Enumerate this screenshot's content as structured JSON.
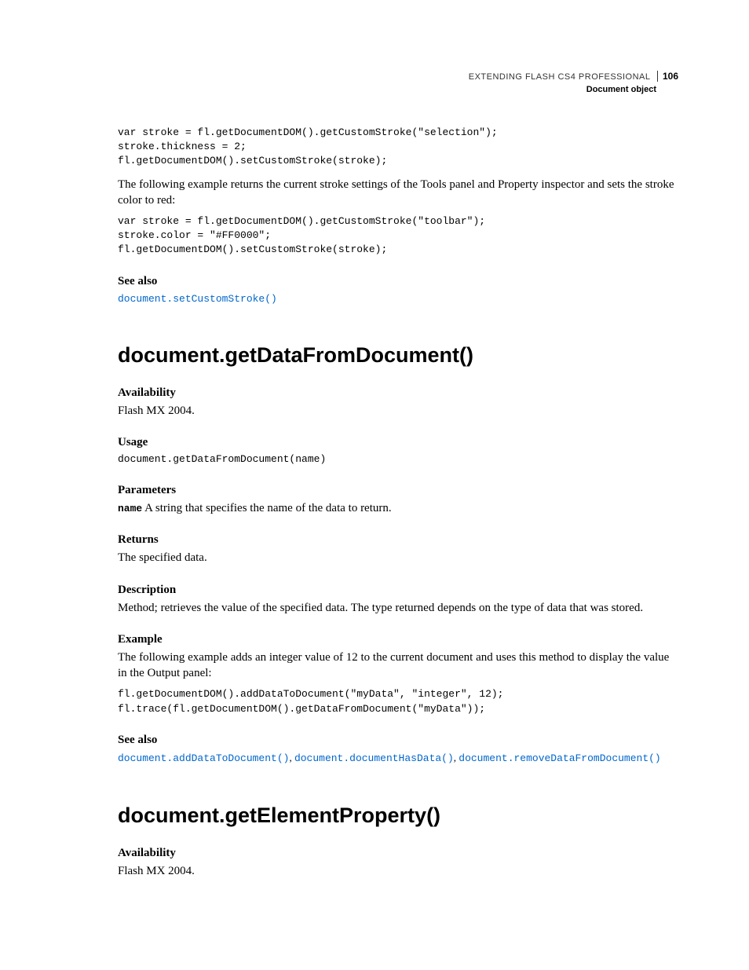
{
  "header": {
    "book_title": "EXTENDING FLASH CS4 PROFESSIONAL",
    "page_number": "106",
    "chapter": "Document object"
  },
  "block1": {
    "code": "var stroke = fl.getDocumentDOM().getCustomStroke(\"selection\");\nstroke.thickness = 2;\nfl.getDocumentDOM().setCustomStroke(stroke);",
    "para": "The following example returns the current stroke settings of the Tools panel and Property inspector and sets the stroke color to red:",
    "code2": "var stroke = fl.getDocumentDOM().getCustomStroke(\"toolbar\");\nstroke.color = \"#FF0000\";\nfl.getDocumentDOM().setCustomStroke(stroke);",
    "see_also_label": "See also",
    "see_also_link": "document.setCustomStroke()"
  },
  "method1": {
    "title": "document.getDataFromDocument()",
    "availability_label": "Availability",
    "availability_text": "Flash MX 2004.",
    "usage_label": "Usage",
    "usage_code": "document.getDataFromDocument(name)",
    "parameters_label": "Parameters",
    "param_name": "name",
    "param_desc": "  A string that specifies the name of the data to return.",
    "returns_label": "Returns",
    "returns_text": "The specified data.",
    "description_label": "Description",
    "description_text": "Method; retrieves the value of the specified data. The type returned depends on the type of data that was stored.",
    "example_label": "Example",
    "example_text": "The following example adds an integer value of 12 to the current document and uses this method to display the value in the Output panel:",
    "example_code": "fl.getDocumentDOM().addDataToDocument(\"myData\", \"integer\", 12);\nfl.trace(fl.getDocumentDOM().getDataFromDocument(\"myData\"));",
    "see_also_label": "See also",
    "see_also_links": {
      "l1": "document.addDataToDocument()",
      "l2": "document.documentHasData()",
      "l3": "document.removeDataFromDocument()"
    }
  },
  "method2": {
    "title": "document.getElementProperty()",
    "availability_label": "Availability",
    "availability_text": "Flash MX 2004."
  }
}
